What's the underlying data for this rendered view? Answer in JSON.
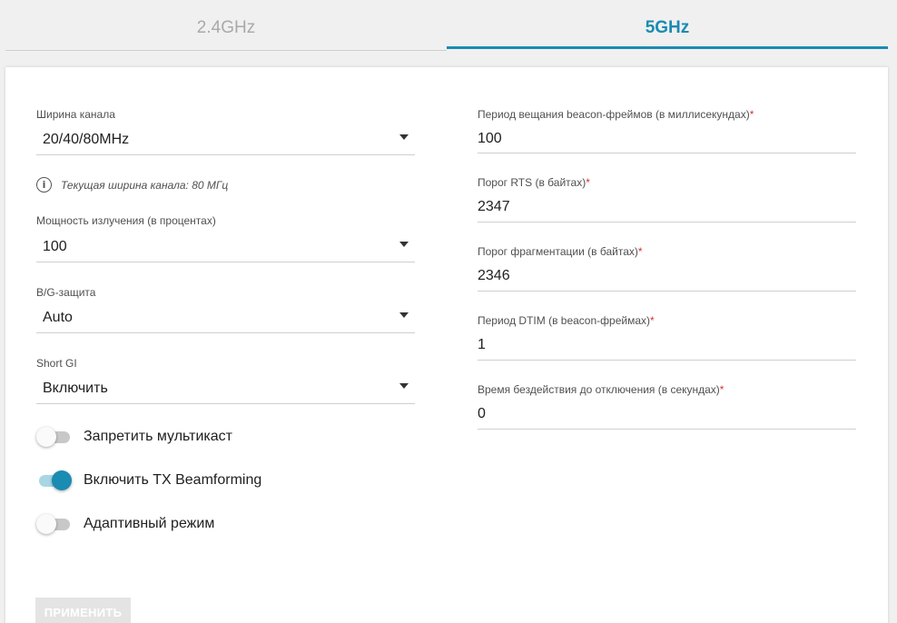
{
  "tabs": [
    {
      "label": "2.4GHz",
      "active": false
    },
    {
      "label": "5GHz",
      "active": true
    }
  ],
  "colors": {
    "accent": "#1a8bb2",
    "required": "#d4342a"
  },
  "left": {
    "channel_width": {
      "label": "Ширина канала",
      "value": "20/40/80MHz"
    },
    "hint": {
      "icon": "info-icon",
      "text": "Текущая ширина канала: 80 МГц"
    },
    "tx_power": {
      "label": "Мощность излучения (в процентах)",
      "value": "100"
    },
    "bg_protection": {
      "label": "B/G-защита",
      "value": "Auto"
    },
    "short_gi": {
      "label": "Short GI",
      "value": "Включить"
    },
    "toggles": [
      {
        "label": "Запретить мультикаст",
        "on": false
      },
      {
        "label": "Включить TX Beamforming",
        "on": true
      },
      {
        "label": "Адаптивный режим",
        "on": false
      }
    ]
  },
  "right": {
    "beacon_period": {
      "label": "Период вещания beacon-фреймов (в миллисекундах)",
      "required": "*",
      "value": "100"
    },
    "rts_threshold": {
      "label": "Порог RTS (в байтах)",
      "required": "*",
      "value": "2347"
    },
    "frag_threshold": {
      "label": "Порог фрагментации (в байтах)",
      "required": "*",
      "value": "2346"
    },
    "dtim_period": {
      "label": "Период DTIM (в beacon-фреймах)",
      "required": "*",
      "value": "1"
    },
    "inactivity_time": {
      "label": "Время бездействия до отключения (в секундах)",
      "required": "*",
      "value": "0"
    }
  },
  "apply_button": {
    "label": "ПРИМЕНИТЬ"
  }
}
